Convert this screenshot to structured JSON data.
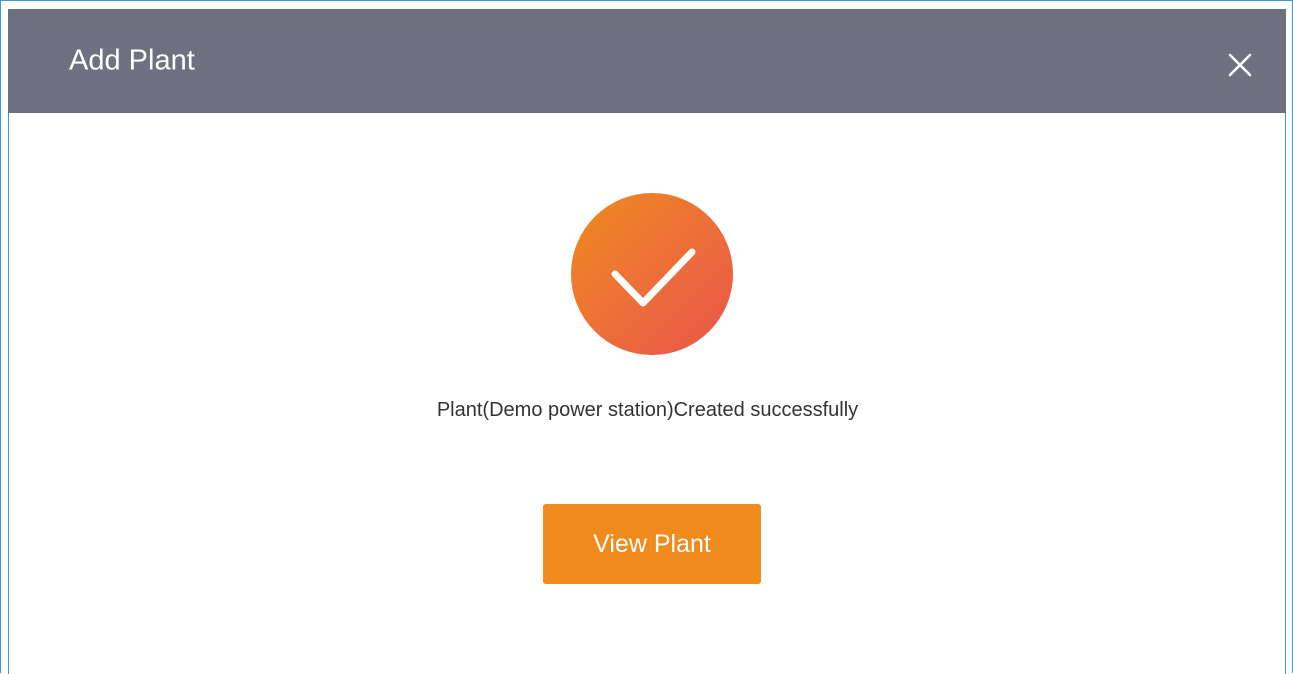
{
  "dialog": {
    "title": "Add Plant",
    "close_icon": "close-icon",
    "success_icon": "checkmark-icon",
    "message": "Plant(Demo power station)Created successfully",
    "primary_button_label": "View Plant"
  },
  "colors": {
    "header_bg": "#6e7180",
    "accent": "#ef8a1c",
    "border": "#3d9ad6",
    "success_gradient_start": "#ef8b1e",
    "success_gradient_end": "#e9554a"
  }
}
